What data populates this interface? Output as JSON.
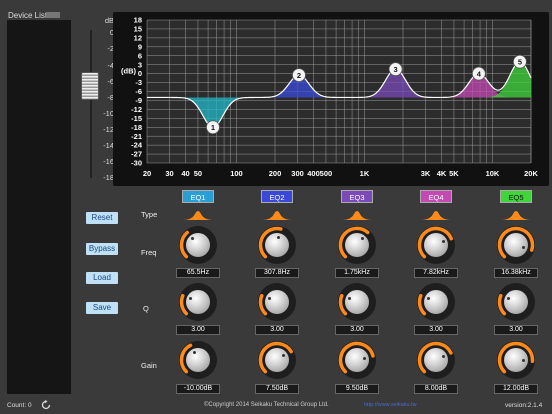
{
  "sidebar": {
    "title": "Device List"
  },
  "fader": {
    "unit": "dB",
    "ticks": [
      "0",
      "-2",
      "-4",
      "-6",
      "-8",
      "-10",
      "-12",
      "-14",
      "-16",
      "-18"
    ]
  },
  "graph": {
    "y_unit": "(dB)",
    "y_ticks": [
      "18",
      "15",
      "12",
      "9",
      "6",
      "3",
      "0",
      "-3",
      "-6",
      "-9",
      "-12",
      "-15",
      "-18",
      "-21",
      "-24",
      "-27",
      "-30"
    ],
    "x_ticks": [
      "20",
      "30",
      "40",
      "50",
      "100",
      "200",
      "300",
      "400",
      "500",
      "1K",
      "3K",
      "4K",
      "5K",
      "10K",
      "20K"
    ],
    "points": [
      "1",
      "2",
      "3",
      "4",
      "5"
    ]
  },
  "side_buttons": {
    "reset": "Reset",
    "bypass": "Bypass",
    "load": "Load",
    "save": "Save"
  },
  "rows": {
    "type": "Type",
    "freq": "Freq",
    "q": "Q",
    "gain": "Gain"
  },
  "bands": [
    {
      "label": "EQ1",
      "color": "#2a9fd6",
      "freq": "65.5Hz",
      "q": "3.00",
      "gain": "-10.00dB"
    },
    {
      "label": "EQ2",
      "color": "#3a49d8",
      "freq": "307.8Hz",
      "q": "3.00",
      "gain": "7.50dB"
    },
    {
      "label": "EQ3",
      "color": "#7a4ab8",
      "freq": "1.75kHz",
      "q": "3.00",
      "gain": "9.50dB"
    },
    {
      "label": "EQ4",
      "color": "#c24ab2",
      "freq": "7.82kHz",
      "q": "3.00",
      "gain": "8.00dB"
    },
    {
      "label": "EQ5",
      "color": "#3fd63a",
      "freq": "16.38kHz",
      "q": "3.00",
      "gain": "12.00dB"
    }
  ],
  "footer": {
    "count": "Count: 0",
    "copyright": "©Copyright 2014 Seikaku Technical Group Ltd.",
    "link": "http://www.seikaku.tw",
    "version": "version:2.1.4"
  },
  "colors": {
    "accent": "#ff8a1a",
    "band_fill": "#22c0c0"
  }
}
